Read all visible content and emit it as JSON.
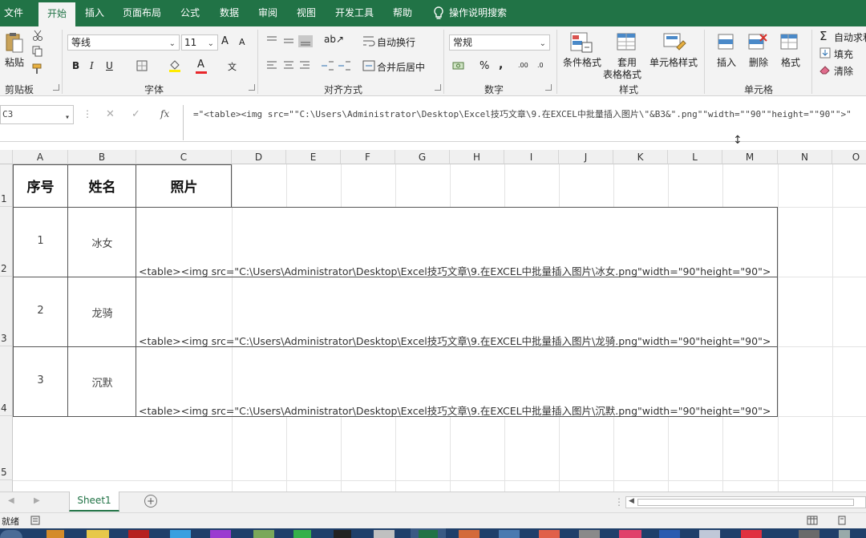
{
  "tabs": [
    {
      "label": "文件",
      "active": false
    },
    {
      "label": "开始",
      "active": true
    },
    {
      "label": "插入",
      "active": false
    },
    {
      "label": "页面布局",
      "active": false
    },
    {
      "label": "公式",
      "active": false
    },
    {
      "label": "数据",
      "active": false
    },
    {
      "label": "审阅",
      "active": false
    },
    {
      "label": "视图",
      "active": false
    },
    {
      "label": "开发工具",
      "active": false
    },
    {
      "label": "帮助",
      "active": false
    }
  ],
  "tell_me": "操作说明搜索",
  "ribbon": {
    "clipboard": {
      "paste": "粘贴",
      "label": "剪贴板"
    },
    "font": {
      "name": "等线",
      "size": "11",
      "bold": "B",
      "italic": "I",
      "underline": "U",
      "grow": "A",
      "shrink": "A",
      "color_glyph": "A",
      "label": "字体"
    },
    "alignment": {
      "wrap": "自动换行",
      "merge": "合并后居中",
      "label": "对齐方式"
    },
    "number": {
      "format": "常规",
      "percent": "%",
      "comma": ",",
      "label": "数字"
    },
    "styles": {
      "conditional": "条件格式",
      "table_line1": "套用",
      "table_line2": "表格格式",
      "cell_styles": "单元格样式",
      "label": "样式"
    },
    "cells": {
      "insert": "插入",
      "delete": "删除",
      "format": "格式",
      "label": "单元格"
    },
    "editing": {
      "autosum": "自动求和",
      "fill": "填充",
      "clear": "清除"
    }
  },
  "formula_bar": {
    "name_box": "C3",
    "fx": "fx",
    "formula": "=\"<table><img src=\"\"C:\\Users\\Administrator\\Desktop\\Excel技巧文章\\9.在EXCEL中批量插入图片\\\"&B3&\".png\"\"width=\"\"90\"\"height=\"\"90\"\">\""
  },
  "columns": [
    "A",
    "B",
    "C",
    "D",
    "E",
    "F",
    "G",
    "H",
    "I",
    "J",
    "K",
    "L",
    "M",
    "N",
    "O"
  ],
  "rows": [
    "1",
    "2",
    "3",
    "4",
    "5"
  ],
  "table": {
    "headers": [
      "序号",
      "姓名",
      "照片"
    ],
    "records": [
      {
        "no": "1",
        "name": "冰女",
        "formula_text": "<table><img src=\"C:\\Users\\Administrator\\Desktop\\Excel技巧文章\\9.在EXCEL中批量插入图片\\冰女.png\"width=\"90\"height=\"90\">"
      },
      {
        "no": "2",
        "name": "龙骑",
        "formula_text": "<table><img src=\"C:\\Users\\Administrator\\Desktop\\Excel技巧文章\\9.在EXCEL中批量插入图片\\龙骑.png\"width=\"90\"height=\"90\">"
      },
      {
        "no": "3",
        "name": "沉默",
        "formula_text": "<table><img src=\"C:\\Users\\Administrator\\Desktop\\Excel技巧文章\\9.在EXCEL中批量插入图片\\沉默.png\"width=\"90\"height=\"90\">"
      }
    ]
  },
  "sheets": [
    {
      "label": "Sheet1",
      "active": true
    }
  ],
  "status": {
    "ready": "就绪"
  },
  "colors": {
    "brand": "#217346",
    "taskbar": "#1f3f6a"
  }
}
